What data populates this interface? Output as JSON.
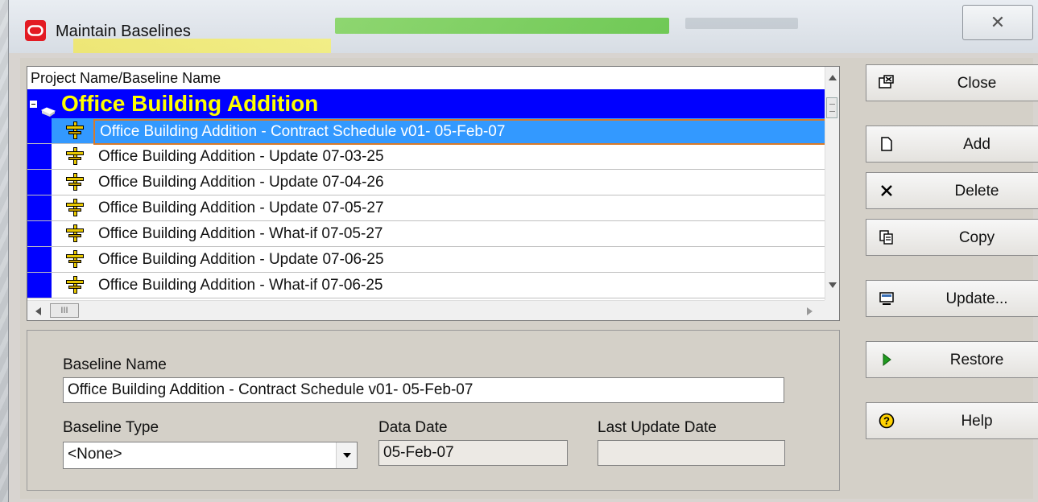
{
  "window": {
    "title": "Maintain Baselines"
  },
  "list": {
    "header": "Project Name/Baseline Name",
    "project": "Office Building Addition",
    "rows": [
      "Office Building Addition - Contract Schedule v01- 05-Feb-07",
      "Office Building Addition - Update 07-03-25",
      "Office Building Addition - Update 07-04-26",
      "Office Building Addition - Update 07-05-27",
      "Office Building Addition - What-if 07-05-27",
      "Office Building Addition - Update 07-06-25",
      "Office Building Addition - What-if 07-06-25"
    ],
    "selected_index": 0,
    "hscroll_thumb": "III"
  },
  "details": {
    "baseline_name_label": "Baseline Name",
    "baseline_name_value": "Office Building Addition - Contract Schedule v01- 05-Feb-07",
    "baseline_type_label": "Baseline Type",
    "baseline_type_value": "<None>",
    "data_date_label": "Data Date",
    "data_date_value": "05-Feb-07",
    "last_update_label": "Last Update Date",
    "last_update_value": ""
  },
  "buttons": {
    "close": "Close",
    "add": "Add",
    "delete": "Delete",
    "copy": "Copy",
    "update": "Update...",
    "restore": "Restore",
    "help": "Help"
  },
  "colors": {
    "project_row_bg": "#0000ff",
    "project_row_fg": "#ffff00",
    "selection": "#3399ff",
    "app_icon": "#e31b23"
  }
}
